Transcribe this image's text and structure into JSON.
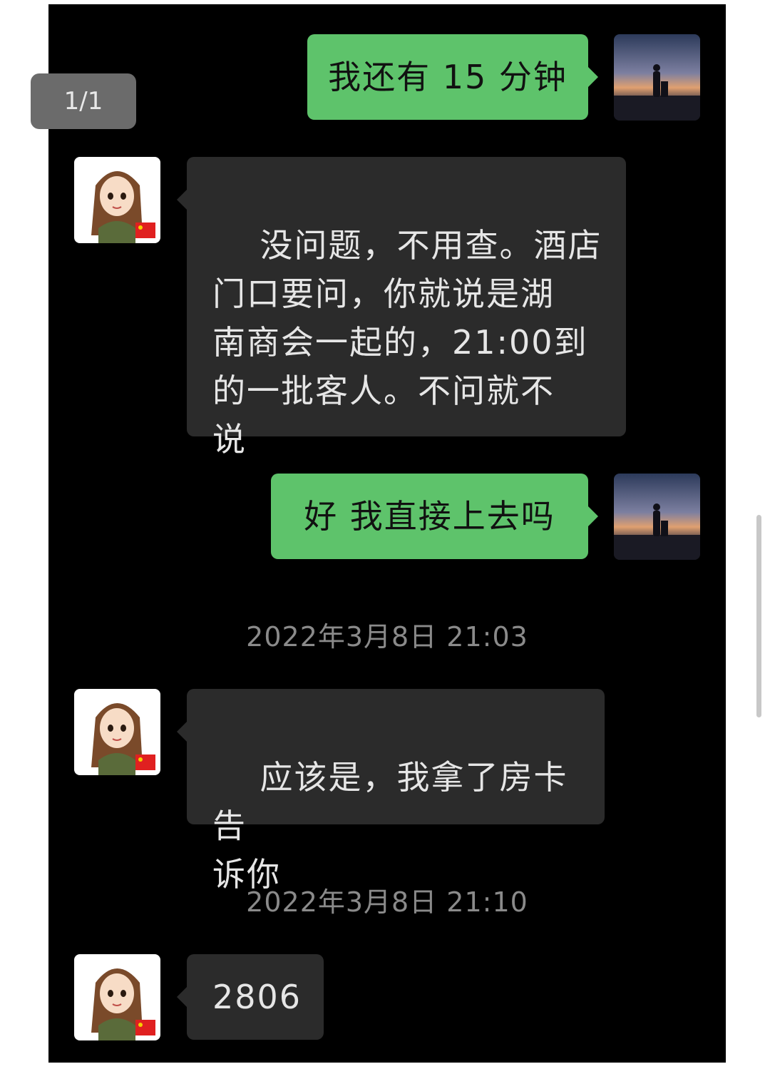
{
  "viewer": {
    "page_indicator": "1/1"
  },
  "colors": {
    "sent_bubble": "#5ec36b",
    "received_bubble": "#2b2b2b",
    "background": "#000000",
    "timestamp_text": "#8a8a8a"
  },
  "messages": [
    {
      "side": "sent",
      "text": "我还有 15 分钟",
      "avatar": "sunset-silhouette-avatar"
    },
    {
      "side": "received",
      "text": "没问题，不用查。酒店\n门口要问，你就说是湖\n南商会一起的，21:00到\n的一批客人。不问就不\n说",
      "avatar": "cartoon-woman-avatar"
    },
    {
      "side": "sent",
      "text": "好 我直接上去吗",
      "avatar": "sunset-silhouette-avatar"
    },
    {
      "side": "received",
      "text": "应该是，我拿了房卡告\n诉你",
      "avatar": "cartoon-woman-avatar"
    },
    {
      "side": "received",
      "text": "2806",
      "avatar": "cartoon-woman-avatar"
    }
  ],
  "timestamps": [
    "2022年3月8日 21:03",
    "2022年3月8日 21:10"
  ]
}
